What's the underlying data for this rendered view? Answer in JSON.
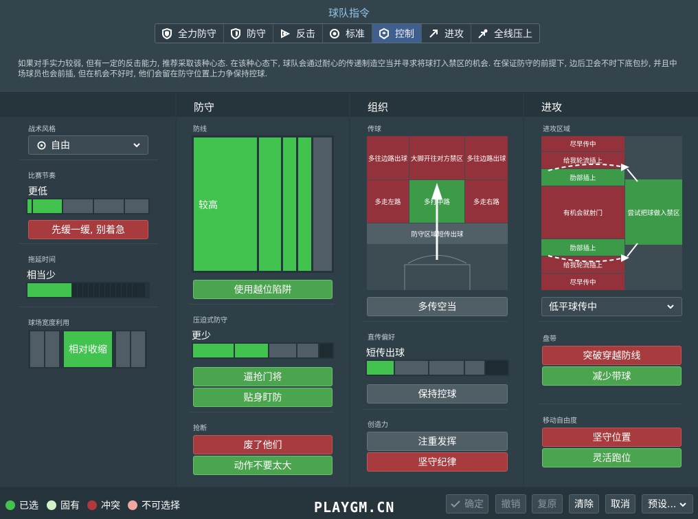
{
  "header": {
    "title": "球队指令",
    "tabs": [
      {
        "label": "全力防守",
        "icon": "shield-double-icon"
      },
      {
        "label": "防守",
        "icon": "shield-icon"
      },
      {
        "label": "反击",
        "icon": "counter-icon"
      },
      {
        "label": "标准",
        "icon": "balanced-icon"
      },
      {
        "label": "控制",
        "icon": "control-icon"
      },
      {
        "label": "进攻",
        "icon": "attack-arrow-icon"
      },
      {
        "label": "全线压上",
        "icon": "all-out-attack-icon"
      }
    ],
    "description": "如果对手实力较弱, 但有一定的反击能力, 推荐采取该种心态. 在该种心态下, 球队会通过耐心的传递制造空当并寻求将球打入禁区的机会. 在保证防守的前提下, 边后卫会不时下底包抄, 并且中场球员也会前插, 但在机会不好时, 他们会留在防守位置上力争保持控球."
  },
  "left": {
    "style_label": "战术风格",
    "style_value": "自由",
    "tempo_label": "比赛节奏",
    "tempo_value": "更低",
    "tempo_level": 0.26,
    "tempo_button": "先缓一缓, 别着急",
    "time_label": "拖延时间",
    "time_value": "相当少",
    "time_level": 0.35,
    "width_label": "球场宽度利用",
    "width_value": "相对收缩"
  },
  "defence": {
    "heading": "防守",
    "line_label": "防线",
    "line_value": "较高",
    "offside_button": "使用越位陷阱",
    "press_label": "压迫式防守",
    "press_value": "更少",
    "press_level": 0.3,
    "press_buttons": [
      "逼抢门将",
      "贴身盯防"
    ],
    "tackle_label": "抢断",
    "tackle_buttons": [
      "废了他们",
      "动作不要太大"
    ]
  },
  "organise": {
    "heading": "组织",
    "pass_label": "传球",
    "zones": {
      "l1": "多往边路出球",
      "c1": "大脚开往对方禁区",
      "r1": "多往边路出球",
      "l2": "多走左路",
      "c2": "多打中路",
      "r2": "多走右路",
      "back": "防守区域短传出球"
    },
    "space_button": "多传空当",
    "build_label": "直传偏好",
    "build_value": "短传出球",
    "build_level": 0.2,
    "hold_button": "保持控球",
    "creative_label": "创造力",
    "creative_buttons": [
      "注重发挥",
      "坚守纪律"
    ]
  },
  "attack": {
    "heading": "进攻",
    "zone_label": "进攻区域",
    "zones": {
      "early1": "尽早传中",
      "overlap1": "给我轮流插上",
      "under1": "肋部插上",
      "shoot": "有机会就射门",
      "workin": "尝试把球做入禁区",
      "under2": "肋部插上",
      "overlap2": "给我轮流插上",
      "early2": "尽早传中"
    },
    "cross_value": "低平球传中",
    "dribble_label": "盘带",
    "dribble_buttons": [
      "突破穿越防线",
      "减少带球"
    ],
    "freedom_label": "移动自由度",
    "freedom_buttons": [
      "坚守位置",
      "灵活跑位"
    ]
  },
  "legend": [
    {
      "label": "已选",
      "color": "#43c24f"
    },
    {
      "label": "固有",
      "color": "#d3f2c8"
    },
    {
      "label": "冲突",
      "color": "#b3383c"
    },
    {
      "label": "不可选择",
      "color": "#f1a6a6"
    }
  ],
  "footer": {
    "confirm": "确定",
    "undo": "撤销",
    "redo": "复原",
    "clear": "清除",
    "cancel": "取消",
    "presets": "预设...",
    "watermark": "PLAYGM.CN"
  }
}
